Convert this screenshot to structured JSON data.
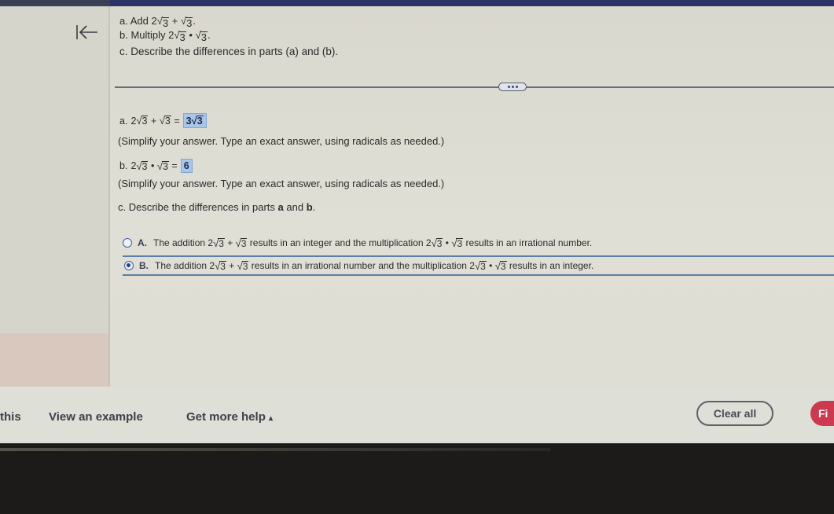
{
  "question": {
    "a": {
      "label": "a.",
      "prefix": "Add",
      "coef1": "2",
      "rad1": "3",
      "op": "+",
      "rad2": "3",
      "end": "."
    },
    "b": {
      "label": "b.",
      "prefix": "Multiply",
      "coef1": "2",
      "rad1": "3",
      "op": "•",
      "rad2": "3",
      "end": "."
    },
    "c": {
      "text": "c. Describe the differences in parts (a) and (b)."
    }
  },
  "more_button": {
    "icon": "ellipsis-icon"
  },
  "answers": {
    "a": {
      "label": "a.",
      "coef1": "2",
      "rad1": "3",
      "op": "+",
      "rad2": "3",
      "eq": "=",
      "answer_coef": "3",
      "answer_rad": "3"
    },
    "a_hint": "(Simplify your answer. Type an exact answer, using radicals as needed.)",
    "b": {
      "label": "b.",
      "coef1": "2",
      "rad1": "3",
      "op": "•",
      "rad2": "3",
      "eq": "=",
      "answer": "6"
    },
    "b_hint": "(Simplify your answer. Type an exact answer, using radicals as needed.)",
    "c_prompt": {
      "pre": "c. Describe the differences in parts ",
      "a": "a",
      "mid": " and ",
      "b": "b",
      "end": "."
    }
  },
  "choices": [
    {
      "letter": "A.",
      "selected": false,
      "pre": "The addition",
      "coef1": "2",
      "rad1": "3",
      "op1": "+",
      "rad2": "3",
      "mid": "results in an integer and the multiplication",
      "coef2": "2",
      "rad3": "3",
      "op2": "•",
      "rad4": "3",
      "post": "results in an irrational number."
    },
    {
      "letter": "B.",
      "selected": true,
      "pre": "The addition",
      "coef1": "2",
      "rad1": "3",
      "op1": "+",
      "rad2": "3",
      "mid": "results in an irrational number and the multiplication",
      "coef2": "2",
      "rad3": "3",
      "op2": "•",
      "rad4": "3",
      "post": "results in an integer."
    }
  ],
  "footer": {
    "link_this": "this",
    "view_example": "View an example",
    "get_more_help": "Get more help",
    "get_more_help_icon": "caret-up-icon",
    "clear_all": "Clear all",
    "final_check": "Fi"
  },
  "colors": {
    "accent": "#3f5fa3",
    "answer_highlight": "#a9c6e8",
    "final_button": "#cd3a4f",
    "topbar": "#2c3266"
  }
}
